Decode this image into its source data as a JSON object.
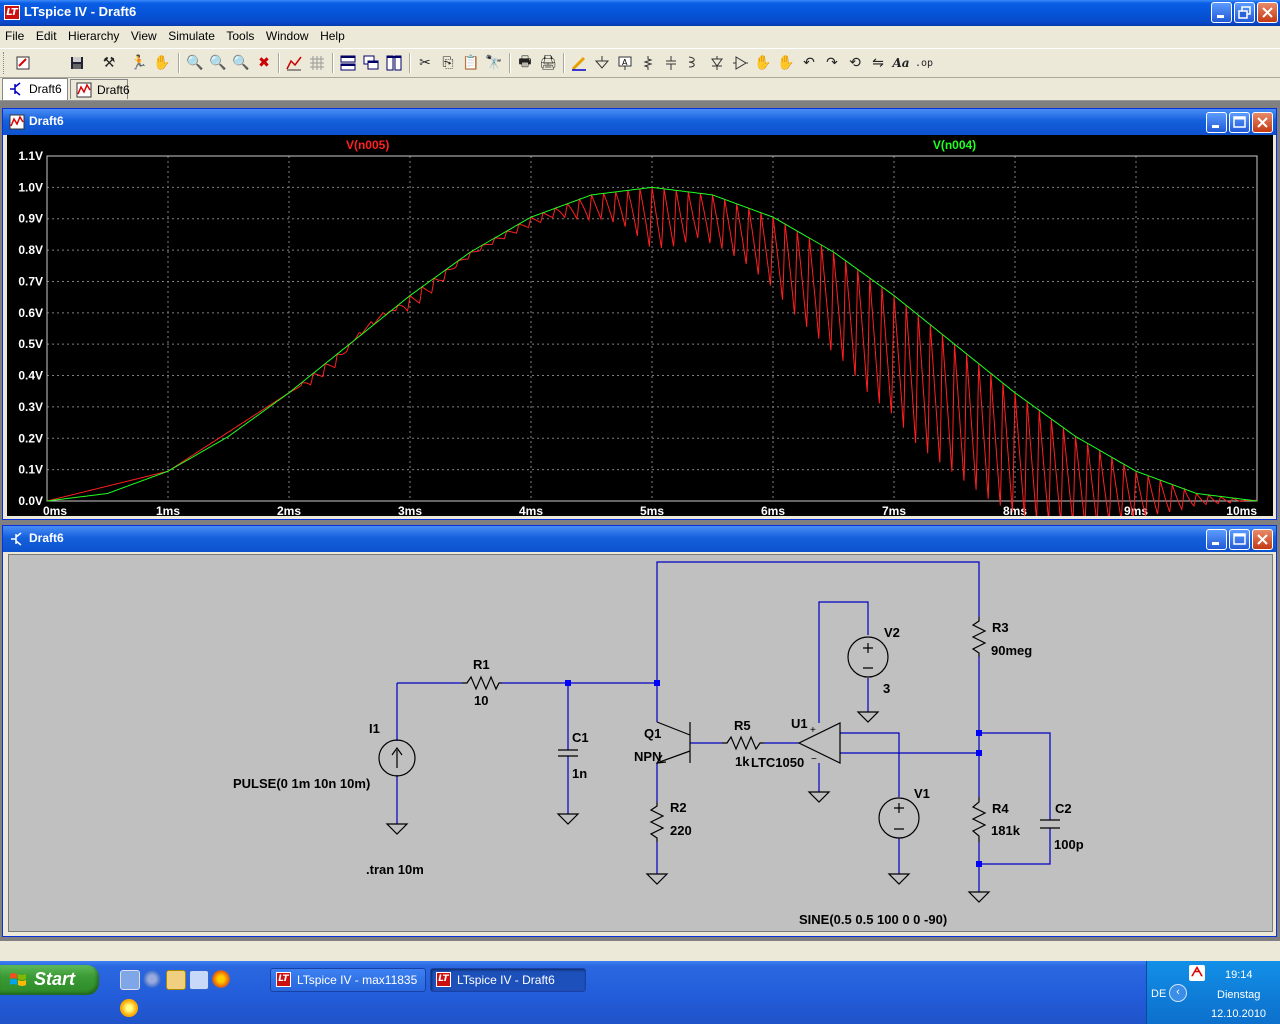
{
  "window": {
    "app_icon": "ltspice-logo-icon",
    "title": "LTspice IV - Draft6"
  },
  "menu": [
    "File",
    "Edit",
    "Hierarchy",
    "View",
    "Simulate",
    "Tools",
    "Window",
    "Help"
  ],
  "toolbar": {
    "buttons": [
      "new-schematic-icon",
      "save-icon",
      "control-panel-icon",
      "run-icon",
      "halt-icon",
      "zoom-in-icon",
      "zoom-full-icon",
      "zoom-out-icon",
      "zoom-cancel-icon",
      "autorange-icon",
      "grid-icon",
      "tile-horizontal-icon",
      "cascade-icon",
      "tile-vertical-icon",
      "cut-icon",
      "copy-icon",
      "paste-icon",
      "find-icon",
      "print-preview-icon",
      "print-icon",
      "draw-wire-icon",
      "ground-icon",
      "label-net-icon",
      "resistor-icon",
      "capacitor-icon",
      "inductor-icon",
      "diode-icon",
      "component-icon",
      "move-icon",
      "drag-icon",
      "undo-icon",
      "redo-icon",
      "rotate-icon",
      "mirror-icon",
      "text-icon",
      "spice-directive-icon"
    ]
  },
  "tabs": [
    {
      "label": "Draft6",
      "icon": "schematic-icon"
    },
    {
      "label": "Draft6",
      "icon": "waveform-icon"
    }
  ],
  "plot_window": {
    "title": "Draft6",
    "icon": "waveform-icon"
  },
  "schematic_window": {
    "title": "Draft6",
    "icon": "schematic-icon"
  },
  "colors": {
    "trace_n005": "#ff2020",
    "trace_n004": "#20ff20",
    "plot_bg": "#000000",
    "grid": "#7f7f7f",
    "wire": "#0000c0",
    "junction": "#0000ff"
  },
  "chart_data": {
    "type": "line",
    "title": "",
    "xlabel": "",
    "ylabel": "",
    "xlim": [
      0,
      10
    ],
    "ylim": [
      0,
      1.1
    ],
    "x_ticks": [
      "0ms",
      "1ms",
      "2ms",
      "3ms",
      "4ms",
      "5ms",
      "6ms",
      "7ms",
      "8ms",
      "9ms",
      "10ms"
    ],
    "y_ticks": [
      "0.0V",
      "0.1V",
      "0.2V",
      "0.3V",
      "0.4V",
      "0.5V",
      "0.6V",
      "0.7V",
      "0.8V",
      "0.9V",
      "1.0V",
      "1.1V"
    ],
    "grid": true,
    "legend": "top",
    "series": [
      {
        "name": "V(n005)",
        "color": "#ff2020",
        "x": [
          0,
          1,
          2,
          2.2,
          2.4,
          2.6,
          2.8,
          3,
          3.2,
          3.4,
          3.6,
          3.8,
          4,
          4.2,
          4.4,
          4.6,
          4.8,
          5,
          5.2,
          5.4,
          5.6,
          5.8,
          6,
          6.2,
          6.4,
          6.6,
          6.8,
          7,
          7.2,
          7.4,
          7.6,
          7.8,
          8,
          8.2,
          8.4,
          8.6,
          8.8,
          9,
          9.2,
          9.4,
          9.6,
          9.8
        ],
        "y": [
          0,
          0.095,
          0.345,
          0.39,
          0.45,
          0.54,
          0.6,
          0.63,
          0.69,
          0.76,
          0.81,
          0.85,
          0.89,
          0.92,
          0.93,
          0.94,
          0.93,
          0.9,
          0.9,
          0.91,
          0.88,
          0.84,
          0.79,
          0.72,
          0.66,
          0.6,
          0.52,
          0.46,
          0.38,
          0.32,
          0.26,
          0.2,
          0.15,
          0.11,
          0.08,
          0.05,
          0.035,
          0.02,
          0.012,
          0.006,
          0.004,
          0.002
        ]
      },
      {
        "name": "V(n004)",
        "color": "#20ff20",
        "x": [
          0,
          0.5,
          1,
          1.5,
          2,
          2.5,
          3,
          3.5,
          4,
          4.5,
          5,
          5.5,
          6,
          6.5,
          7,
          7.5,
          8,
          8.5,
          9,
          9.5,
          10
        ],
        "y": [
          0,
          0.024,
          0.095,
          0.206,
          0.345,
          0.5,
          0.655,
          0.794,
          0.905,
          0.976,
          1.0,
          0.976,
          0.905,
          0.794,
          0.655,
          0.5,
          0.345,
          0.206,
          0.095,
          0.024,
          0
        ]
      }
    ]
  },
  "schematic": {
    "components": {
      "I1": {
        "ref": "I1",
        "value": "PULSE(0 1m 10n 10m)"
      },
      "R1": {
        "ref": "R1",
        "value": "10"
      },
      "C1": {
        "ref": "C1",
        "value": "1n"
      },
      "Q1": {
        "ref": "Q1",
        "value": "NPN"
      },
      "R2": {
        "ref": "R2",
        "value": "220"
      },
      "R5": {
        "ref": "R5",
        "value": "1k"
      },
      "U1": {
        "ref": "U1",
        "value": "LTC1050"
      },
      "V2": {
        "ref": "V2",
        "value": "3"
      },
      "V1": {
        "ref": "V1",
        "value": "SINE(0.5 0.5 100 0 0 -90)"
      },
      "R3": {
        "ref": "R3",
        "value": "90meg"
      },
      "R4": {
        "ref": "R4",
        "value": "181k"
      },
      "C2": {
        "ref": "C2",
        "value": "100p"
      }
    },
    "directive": ".tran 10m"
  },
  "taskbar": {
    "start_label": "Start",
    "quick_launch": [
      "show-desktop-icon",
      "internet-explorer-icon",
      "explorer-icon",
      "outlook-icon",
      "firefox-icon",
      "media-player-icon"
    ],
    "tasks": [
      {
        "label": "LTspice IV - max11835",
        "active": false
      },
      {
        "label": "LTspice IV - Draft6",
        "active": true
      }
    ],
    "tray": {
      "language": "DE",
      "time": "19:14",
      "day": "Dienstag",
      "date": "12.10.2010"
    }
  }
}
